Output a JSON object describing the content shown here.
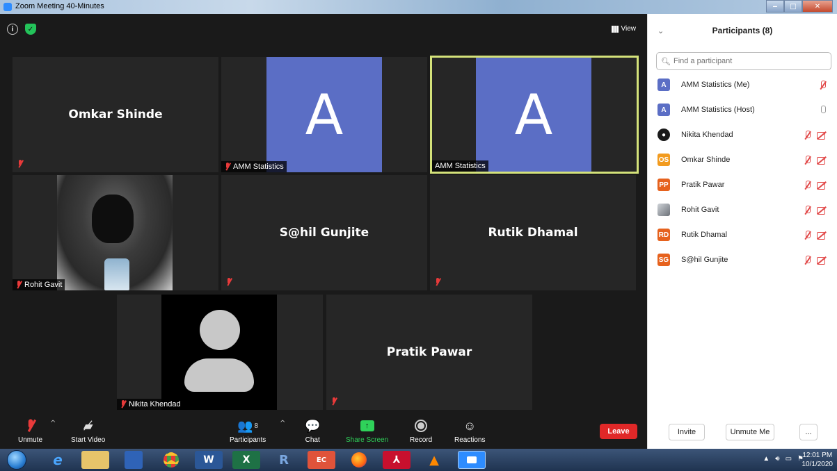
{
  "window": {
    "title": "Zoom Meeting 40-Minutes"
  },
  "view_button": {
    "label": "View"
  },
  "tiles": {
    "omkar": {
      "name": "Omkar Shinde"
    },
    "amm1": {
      "letter": "A",
      "label": "AMM Statistics"
    },
    "amm2": {
      "letter": "A",
      "label": "AMM Statistics"
    },
    "rohit": {
      "label": "Rohit Gavit"
    },
    "sahil": {
      "name": "S@hil Gunjite"
    },
    "rutik": {
      "name": "Rutik Dhamal"
    },
    "nikita": {
      "label": "Nikita Khendad"
    },
    "pratik": {
      "name": "Pratik Pawar"
    }
  },
  "toolbar": {
    "unmute": "Unmute",
    "start_video": "Start Video",
    "participants": "Participants",
    "participants_count": "8",
    "chat": "Chat",
    "share_screen": "Share Screen",
    "record": "Record",
    "reactions": "Reactions",
    "leave": "Leave"
  },
  "panel": {
    "title": "Participants (8)",
    "search_placeholder": "Find a participant",
    "participants": [
      {
        "initials": "A",
        "name": "AMM Statistics (Me)",
        "color": "#5b6ec5"
      },
      {
        "initials": "A",
        "name": "AMM Statistics (Host)",
        "color": "#5b6ec5"
      },
      {
        "initials": "",
        "name": "Nikita Khendad",
        "color": "#1a1a1a"
      },
      {
        "initials": "OS",
        "name": "Omkar Shinde",
        "color": "#f29b1f"
      },
      {
        "initials": "PP",
        "name": "Pratik Pawar",
        "color": "#e6621e"
      },
      {
        "initials": "",
        "name": "Rohit Gavit",
        "color": "#8a8f96"
      },
      {
        "initials": "RD",
        "name": "Rutik Dhamal",
        "color": "#e6621e"
      },
      {
        "initials": "SG",
        "name": "S@hil Gunjite",
        "color": "#e6621e"
      }
    ],
    "invite": "Invite",
    "unmute_me": "Unmute Me",
    "more": "..."
  },
  "taskbar": {
    "time": "12:01 PM",
    "date": "10/1/2020"
  },
  "colors": {
    "accent_green": "#2fd25a",
    "leave_red": "#e02828",
    "avatar_blue": "#5b6ec5",
    "active_speaker": "#d4e27a"
  }
}
